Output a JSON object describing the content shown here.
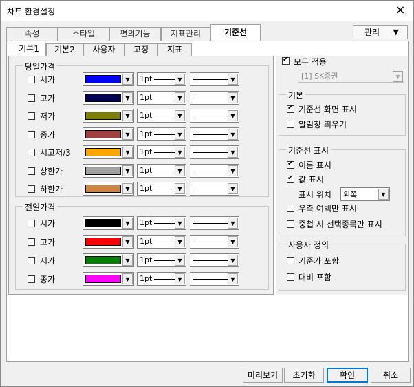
{
  "window": {
    "title": "차트 환경설정",
    "close_icon": "×"
  },
  "tabs": [
    "속성",
    "스타일",
    "편의기능",
    "지표관리",
    "기준선"
  ],
  "manage": {
    "label": "관리",
    "arrow": "▼"
  },
  "subtabs": [
    "기본1",
    "기본2",
    "사용자",
    "고정",
    "지표"
  ],
  "today_group": {
    "title": "당일가격",
    "rows": [
      {
        "label": "시가",
        "color": "#0000ff",
        "width": "1pt",
        "checked": false
      },
      {
        "label": "고가",
        "color": "#000050",
        "width": "1pt",
        "checked": false
      },
      {
        "label": "저가",
        "color": "#808000",
        "width": "1pt",
        "checked": false
      },
      {
        "label": "종가",
        "color": "#a04040",
        "width": "1pt",
        "checked": false
      },
      {
        "label": "시고저/3",
        "color": "#ffa500",
        "width": "1pt",
        "checked": false
      },
      {
        "label": "상한가",
        "color": "#a0a0a0",
        "width": "1pt",
        "checked": false
      },
      {
        "label": "하한가",
        "color": "#cd853f",
        "width": "1pt",
        "checked": false
      }
    ]
  },
  "prev_group": {
    "title": "전일가격",
    "rows": [
      {
        "label": "시가",
        "color": "#000000",
        "width": "1pt",
        "checked": false
      },
      {
        "label": "고가",
        "color": "#ff0000",
        "width": "1pt",
        "checked": false
      },
      {
        "label": "저가",
        "color": "#008000",
        "width": "1pt",
        "checked": false
      },
      {
        "label": "종가",
        "color": "#ff00ff",
        "width": "1pt",
        "checked": false
      }
    ]
  },
  "apply_all": {
    "label": "모두 적용",
    "checked": true,
    "source": "[1] SK증권"
  },
  "basic_group": {
    "title": "기본",
    "items": [
      {
        "label": "기준선 화면 표시",
        "checked": true
      },
      {
        "label": "알림창 띄우기",
        "checked": false
      }
    ]
  },
  "display_group": {
    "title": "기준선 표시",
    "name_show": {
      "label": "이름 표시",
      "checked": true
    },
    "value_show": {
      "label": "값 표시",
      "checked": true
    },
    "position_label": "표시 위치",
    "position_value": "왼쪽",
    "right_margin": {
      "label": "우측 여백만 표시",
      "checked": false
    },
    "overlap": {
      "label": "중첩 시 선택종목만 표시",
      "checked": false
    }
  },
  "user_group": {
    "title": "사용자 정의",
    "items": [
      {
        "label": "기준가 포함",
        "checked": false
      },
      {
        "label": "대비 포함",
        "checked": false
      }
    ]
  },
  "buttons": {
    "preview": "미리보기",
    "reset": "초기화",
    "ok": "확인",
    "cancel": "취소"
  }
}
